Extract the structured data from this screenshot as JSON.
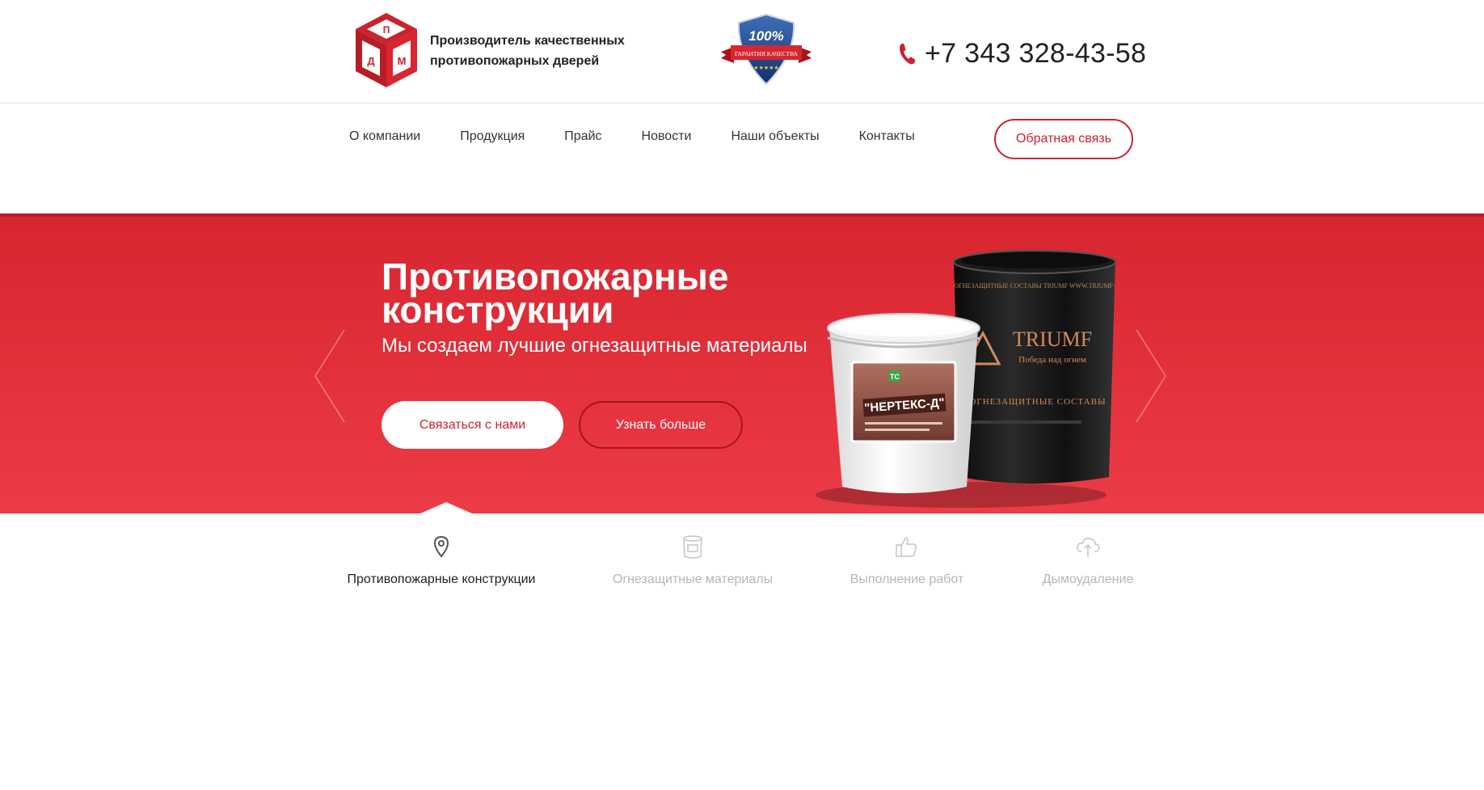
{
  "header": {
    "logo_letters": [
      "П",
      "Д",
      "М"
    ],
    "tagline_line1": "Производитель качественных",
    "tagline_line2": "противопожарных дверей",
    "badge": {
      "percent": "100%",
      "ribbon_text": "ГАРАНТИЯ КАЧЕСТВА"
    },
    "phone": "+7 343 328-43-58",
    "phone_icon": "phone-icon"
  },
  "nav": {
    "items": [
      "О компании",
      "Продукция",
      "Прайс",
      "Новости",
      "Наши объекты",
      "Контакты"
    ],
    "feedback_label": "Обратная связь"
  },
  "hero": {
    "title": "Противопожарные конструкции",
    "subtitle": "Мы создаем лучшие огнезащитные материалы",
    "contact_label": "Связаться с нами",
    "more_label": "Узнать больше",
    "product_bucket_label": "\"НЕРТЕКС-Д\"",
    "product_bucket_brand": "ТС",
    "product_can_top_text": "ОГНЕЗАЩИТНЫЕ СОСТАВЫ TRIUMF   WWW.TRIUMF-",
    "product_can_brand": "TRIUMF",
    "product_can_slogan": "Победа над огнем",
    "product_can_caption": "ОГНЕЗАЩИТНЫЕ СОСТАВЫ",
    "colors": {
      "accent": "#c9232f",
      "hero_top": "#d72630",
      "hero_bottom": "#ec3c47"
    }
  },
  "features": [
    {
      "label": "Противопожарные конструкции",
      "icon": "location-pin-icon",
      "active": true
    },
    {
      "label": "Огнезащитные материалы",
      "icon": "bucket-icon",
      "active": false
    },
    {
      "label": "Выполнение работ",
      "icon": "thumbs-up-icon",
      "active": false
    },
    {
      "label": "Дымоудаление",
      "icon": "cloud-upload-icon",
      "active": false
    }
  ]
}
